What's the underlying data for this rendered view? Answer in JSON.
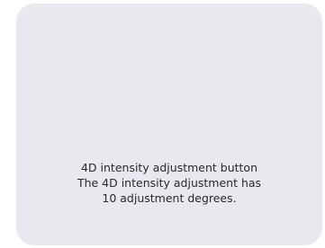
{
  "card": {
    "title": "4D intensity adjustment button",
    "description_line1": "The 4D intensity adjustment has",
    "description_line2": "10 adjustment degrees."
  }
}
